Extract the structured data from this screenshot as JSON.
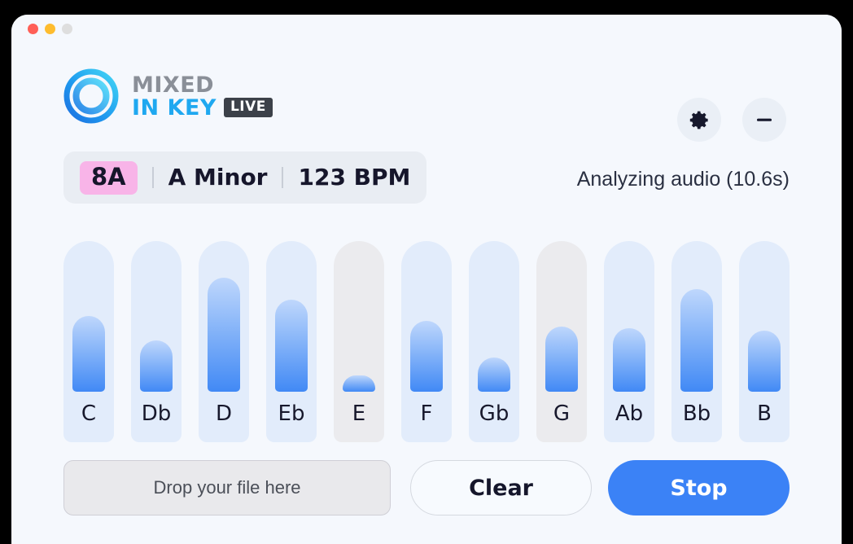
{
  "window": {
    "traffic_lights": [
      {
        "name": "close",
        "color": "#FF5F57"
      },
      {
        "name": "minimize",
        "color": "#FEBC2E"
      },
      {
        "name": "zoom",
        "color": "#DEDEDE"
      }
    ]
  },
  "header": {
    "brand_line1": "MIXED",
    "brand_line2": "IN KEY",
    "brand_badge": "LIVE",
    "brand_color_primary": "#1FA8F0",
    "brand_color_secondary": "#8A8F98",
    "settings_icon": "gear-icon",
    "minimize_icon": "minus-icon"
  },
  "key_info": {
    "camelot": "8A",
    "camelot_color": "#F8B4E8",
    "key_name": "A Minor",
    "bpm": "123 BPM"
  },
  "status": {
    "text": "Analyzing audio (10.6s)"
  },
  "chart_data": {
    "type": "bar",
    "title": "",
    "xlabel": "",
    "ylabel": "",
    "ylim": [
      0,
      100
    ],
    "grid": false,
    "legend": "none",
    "categories": [
      "C",
      "Db",
      "D",
      "Eb",
      "E",
      "F",
      "Gb",
      "G",
      "Ab",
      "Bb",
      "B"
    ],
    "values": [
      62,
      42,
      93,
      75,
      10,
      58,
      28,
      53,
      52,
      84,
      50
    ],
    "track_active_color": "#E2ECFB",
    "track_inactive_color": "#EBEBEE",
    "fill_gradient_top": "#BFD7FC",
    "fill_gradient_bottom": "#4189F5",
    "bars": [
      {
        "note": "C",
        "value": 62,
        "active": true
      },
      {
        "note": "Db",
        "value": 42,
        "active": true
      },
      {
        "note": "D",
        "value": 93,
        "active": true
      },
      {
        "note": "Eb",
        "value": 75,
        "active": true
      },
      {
        "note": "E",
        "value": 10,
        "active": false
      },
      {
        "note": "F",
        "value": 58,
        "active": true
      },
      {
        "note": "Gb",
        "value": 28,
        "active": true
      },
      {
        "note": "G",
        "value": 53,
        "active": false
      },
      {
        "note": "Ab",
        "value": 52,
        "active": true
      },
      {
        "note": "Bb",
        "value": 84,
        "active": true
      },
      {
        "note": "B",
        "value": 50,
        "active": true
      }
    ]
  },
  "footer": {
    "dropzone_label": "Drop your file here",
    "clear_label": "Clear",
    "stop_label": "Stop",
    "stop_color": "#3B82F6"
  }
}
